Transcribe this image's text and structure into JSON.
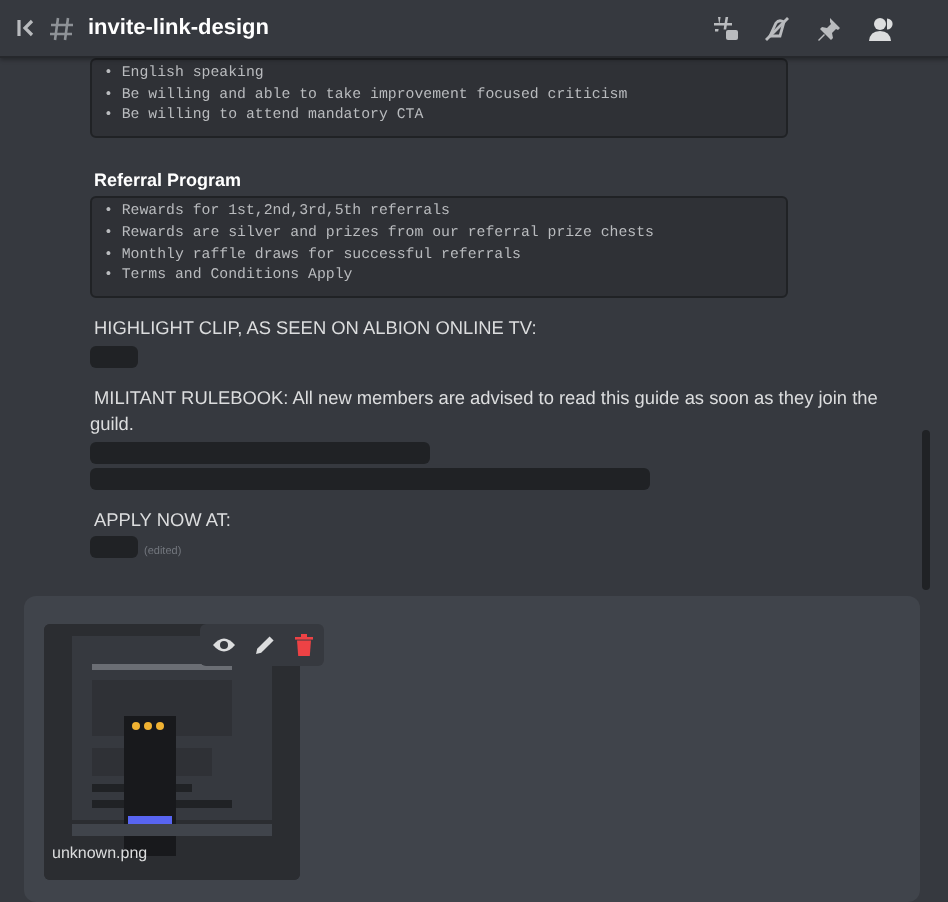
{
  "header": {
    "channel": "invite-link-design"
  },
  "blocks": [
    {
      "kind": "code",
      "lines": [
        "• English speaking",
        "• Be willing and able to take improvement focused criticism",
        "• Be willing to attend mandatory CTA"
      ]
    },
    {
      "kind": "heading",
      "text": "Referral Program"
    },
    {
      "kind": "code",
      "lines": [
        "• Rewards for 1st,2nd,3rd,5th referrals",
        "• Rewards are silver and prizes from our referral prize chests",
        "• Monthly raffle draws for successful referrals",
        "• Terms and Conditions Apply"
      ]
    },
    {
      "kind": "text",
      "text": "HIGHLIGHT CLIP, AS SEEN ON ALBION ONLINE TV:"
    },
    {
      "kind": "spoiler"
    },
    {
      "kind": "text",
      "text": "MILITANT RULEBOOK: All new members are advised to read this guide as soon as they join the guild."
    },
    {
      "kind": "spoiler"
    },
    {
      "kind": "spoiler"
    },
    {
      "kind": "text",
      "text": "APPLY NOW AT:"
    },
    {
      "kind": "spoiler",
      "edited": "(edited)"
    }
  ],
  "attachment": {
    "filename": "unknown.png"
  }
}
